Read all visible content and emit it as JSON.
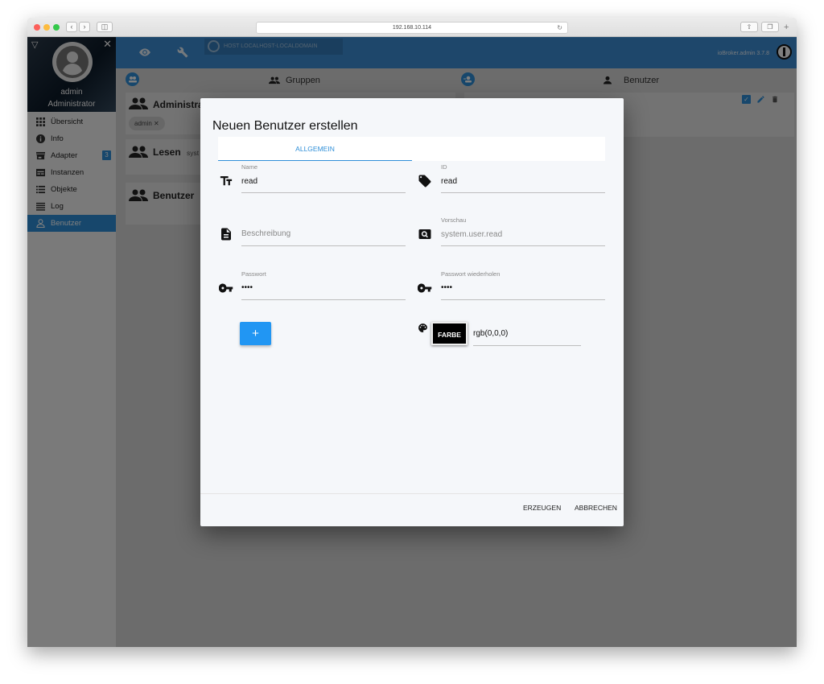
{
  "browser": {
    "url": "192.168.10.114"
  },
  "sidebar": {
    "username": "admin",
    "role": "Administrator",
    "items": [
      {
        "label": "Übersicht",
        "icon": "apps-icon"
      },
      {
        "label": "Info",
        "icon": "info-icon"
      },
      {
        "label": "Adapter",
        "icon": "store-icon",
        "badge": "3"
      },
      {
        "label": "Instanzen",
        "icon": "instances-icon"
      },
      {
        "label": "Objekte",
        "icon": "list-icon"
      },
      {
        "label": "Log",
        "icon": "log-icon"
      },
      {
        "label": "Benutzer",
        "icon": "user-outline-icon",
        "active": true
      }
    ]
  },
  "header": {
    "brand": "HOST LOCALHOST-LOCALDOMAIN",
    "version": "ioBroker.admin 3.7.8"
  },
  "groups_panel": {
    "title": "Gruppen",
    "groups": [
      {
        "name": "Administra",
        "chip": "admin"
      },
      {
        "name": "Lesen",
        "desc": "syst"
      },
      {
        "name": "Benutzer"
      }
    ]
  },
  "users_panel": {
    "title": "Benutzer"
  },
  "dialog": {
    "title": "Neuen Benutzer erstellen",
    "tab": "ALLGEMEIN",
    "fields": {
      "name": {
        "label": "Name",
        "value": "read"
      },
      "id": {
        "label": "ID",
        "value": "read"
      },
      "description": {
        "placeholder": "Beschreibung"
      },
      "preview": {
        "label": "Vorschau",
        "value": "system.user.read"
      },
      "password": {
        "label": "Passwort",
        "value": "••••"
      },
      "password_repeat": {
        "label": "Passwort wiederholen",
        "value": "••••"
      },
      "color": {
        "button": "FARBE",
        "value": "rgb(0,0,0)"
      }
    },
    "plus_label": "+",
    "actions": {
      "create": "ERZEUGEN",
      "cancel": "ABBRECHEN"
    }
  },
  "colors": {
    "accent": "#2f8fd8",
    "topbar": "#3d8fd6",
    "primary_button": "#2196f3"
  }
}
